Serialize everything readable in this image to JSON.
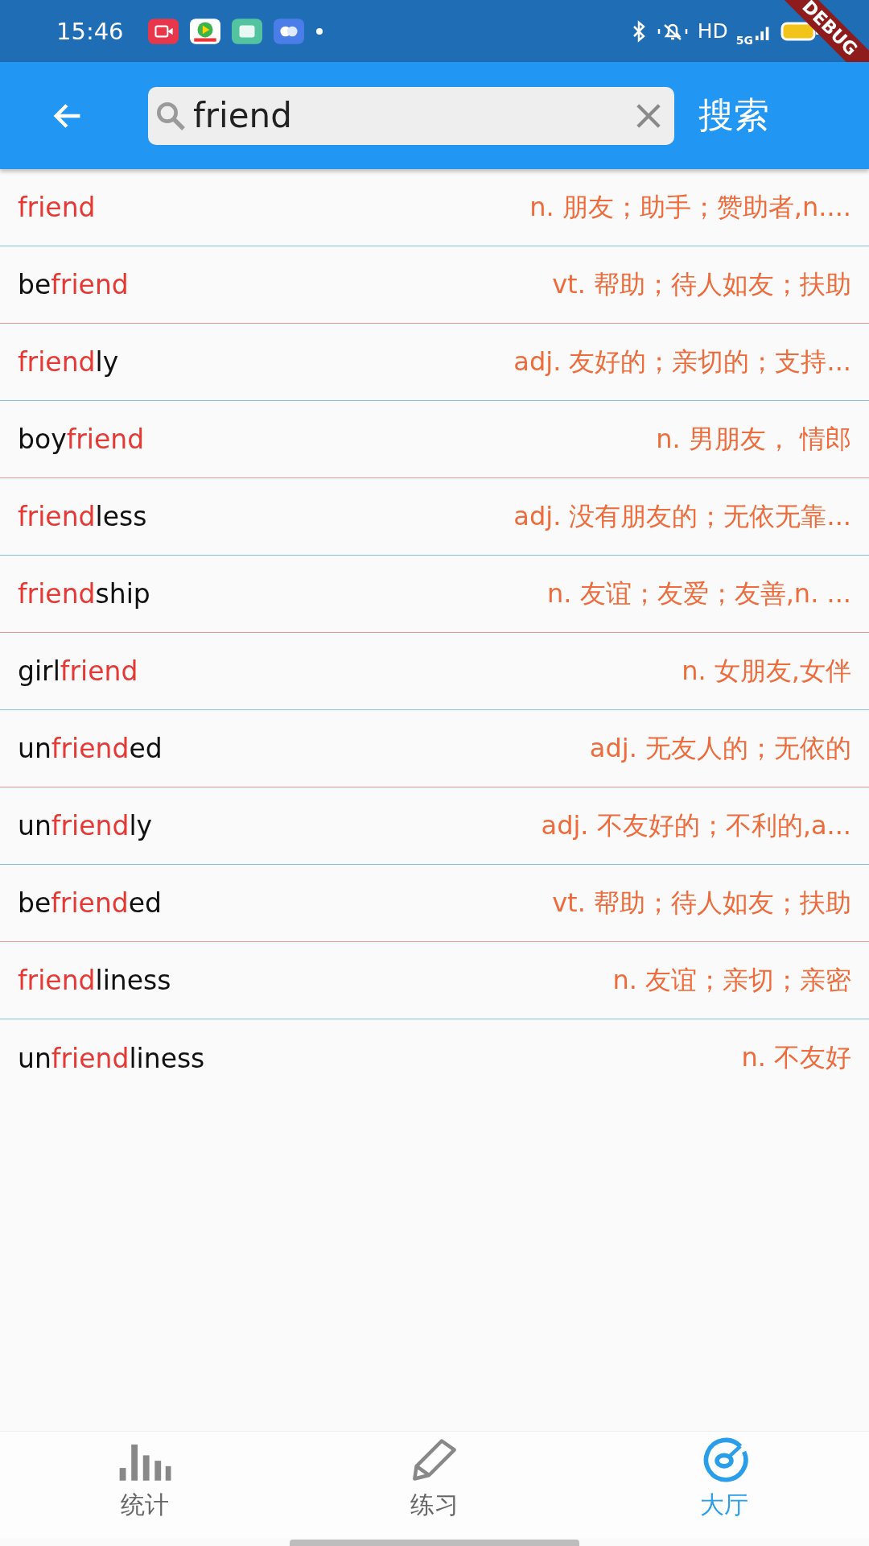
{
  "status_bar": {
    "time": "15:46",
    "network": "HD",
    "cellular": "5G"
  },
  "debug_banner": "DEBUG",
  "search": {
    "value": "friend",
    "button": "搜索"
  },
  "results": [
    {
      "word": [
        {
          "text": "friend",
          "match": true
        }
      ],
      "definition": "n. 朋友；助手；赞助者,n...."
    },
    {
      "word": [
        {
          "text": "be",
          "match": false
        },
        {
          "text": "friend",
          "match": true
        }
      ],
      "definition": "vt. 帮助；待人如友；扶助"
    },
    {
      "word": [
        {
          "text": "friend",
          "match": true
        },
        {
          "text": "ly",
          "match": false
        }
      ],
      "definition": "adj. 友好的；亲切的；支持..."
    },
    {
      "word": [
        {
          "text": "boy",
          "match": false
        },
        {
          "text": "friend",
          "match": true
        }
      ],
      "definition": "n. 男朋友， 情郎"
    },
    {
      "word": [
        {
          "text": "friend",
          "match": true
        },
        {
          "text": "less",
          "match": false
        }
      ],
      "definition": "adj. 没有朋友的；无依无靠..."
    },
    {
      "word": [
        {
          "text": "friend",
          "match": true
        },
        {
          "text": "ship",
          "match": false
        }
      ],
      "definition": "n. 友谊；友爱；友善,n. ..."
    },
    {
      "word": [
        {
          "text": "girl",
          "match": false
        },
        {
          "text": "friend",
          "match": true
        }
      ],
      "definition": "n. 女朋友,女伴"
    },
    {
      "word": [
        {
          "text": "un",
          "match": false
        },
        {
          "text": "friend",
          "match": true
        },
        {
          "text": "ed",
          "match": false
        }
      ],
      "definition": "adj. 无友人的；无依的"
    },
    {
      "word": [
        {
          "text": "un",
          "match": false
        },
        {
          "text": "friend",
          "match": true
        },
        {
          "text": "ly",
          "match": false
        }
      ],
      "definition": "adj. 不友好的；不利的,a..."
    },
    {
      "word": [
        {
          "text": "be",
          "match": false
        },
        {
          "text": "friend",
          "match": true
        },
        {
          "text": "ed",
          "match": false
        }
      ],
      "definition": "vt. 帮助；待人如友；扶助"
    },
    {
      "word": [
        {
          "text": "friend",
          "match": true
        },
        {
          "text": "liness",
          "match": false
        }
      ],
      "definition": "n. 友谊；亲切；亲密"
    },
    {
      "word": [
        {
          "text": "un",
          "match": false
        },
        {
          "text": "friend",
          "match": true
        },
        {
          "text": "liness",
          "match": false
        }
      ],
      "definition": "n. 不友好"
    }
  ],
  "bottom_nav": [
    {
      "kind": "stats",
      "label": "统计",
      "selected": false
    },
    {
      "kind": "practice",
      "label": "练习",
      "selected": false
    },
    {
      "kind": "hall",
      "label": "大厅",
      "selected": true
    }
  ]
}
